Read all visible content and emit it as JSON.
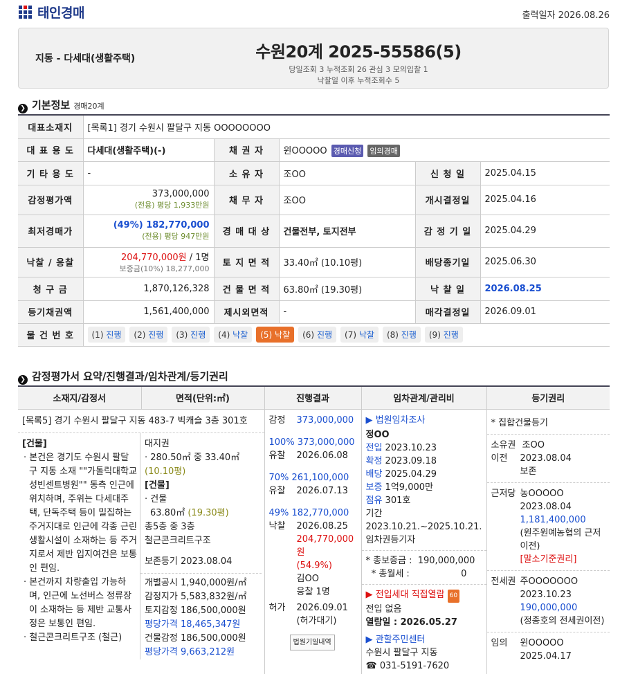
{
  "brand": {
    "name": "태인경매"
  },
  "print_date": "출력일자 2026.08.26",
  "header": {
    "property_type": "지동 - 다세대(생활주택)",
    "case_no": "수원20계 2025-55586(5)",
    "stats": "당일조회 3   누적조회 26   관심 3   모의입찰 1",
    "stats2": "낙찰일 이후 누적조회수 5"
  },
  "basic": {
    "title": "기본정보",
    "sub": "경매20계",
    "labels": {
      "addr": "대표소재지",
      "use": "대 표 용 도",
      "other_use": "기 타 용 도",
      "appraisal": "감정평가액",
      "min_price": "최저경매가",
      "bid": "낙찰 / 응찰",
      "claim": "청 구 금",
      "reg_claim": "등기채권액",
      "item_no": "물 건 번 호",
      "creditor": "채 권 자",
      "owner": "소 유 자",
      "debtor": "채 무 자",
      "target": "경 매 대 상",
      "land_area": "토 지 면 적",
      "bldg_area": "건 물 면 적",
      "excl_area": "제시외면적",
      "apply": "신 청 일",
      "start": "개시결정일",
      "appr_date": "감 정 기 일",
      "div_end": "배당종기일",
      "won_date": "낙 찰 일",
      "sale_decision": "매각결정일"
    },
    "addr": "[목록1] 경기 수원시 팔달구 지동 OOOOOOOO",
    "use": "다세대(생활주택)(-)",
    "other_use": "-",
    "appraisal": "373,000,000",
    "appraisal_sub": "(전용) 평당 1,933만원",
    "min_price": "(49%) 182,770,000",
    "min_price_sub": "(전용) 평당 947만원",
    "bid_price": "204,770,000원",
    "bid_count": " / 1명",
    "deposit": "보증금(10%) 18,277,000",
    "claim": "1,870,126,328",
    "reg_claim": "1,561,400,000",
    "creditor": "윈OOOOO",
    "badge1": "경매신청",
    "badge2": "임의경매",
    "owner": "조OO",
    "debtor": "조OO",
    "target": "건물전부, 토지전부",
    "land_area": "33.40㎡ (10.10평)",
    "bldg_area": "63.80㎡ (19.30평)",
    "excl_area": "-",
    "apply": "2025.04.15",
    "start": "2025.04.16",
    "appr_date": "2025.04.29",
    "div_end": "2025.06.30",
    "won_date": "2026.08.25",
    "sale_decision": "2026.09.01",
    "items": [
      {
        "n": "(1)",
        "s": "진행"
      },
      {
        "n": "(2)",
        "s": "진행"
      },
      {
        "n": "(3)",
        "s": "진행"
      },
      {
        "n": "(4)",
        "s": "낙찰"
      },
      {
        "n": "(5)",
        "s": "낙찰"
      },
      {
        "n": "(6)",
        "s": "진행"
      },
      {
        "n": "(7)",
        "s": "낙찰"
      },
      {
        "n": "(8)",
        "s": "진행"
      },
      {
        "n": "(9)",
        "s": "진행"
      }
    ]
  },
  "summary": {
    "title": "감정평가서 요약/진행결과/임차관계/등기권리",
    "cols": [
      "소재지/감정서",
      "면적(단위:㎡)",
      "진행결과",
      "임차관계/관리비",
      "등기권리"
    ],
    "location": "[목록5] 경기 수원시 팔달구 지동 483-7 빅캐슬 3층 301호",
    "bldg_head": "[건물]",
    "bullets": [
      "본건은 경기도 수원시 팔달구 지동 소재 \"\"가톨릭대학교 성빈센트병원\"\" 동측 인근에 위치하며, 주위는 다세대주택, 단독주택 등이 밀집하는 주거지대로 인근에 각종 근린생활시설이 소재하는 등 주거지로서 제반 입지여건은 보통인 편임.",
      "본건까지 차량출입 가능하며, 인근에 노선버스 정류장이 소재하는 등 제반 교통사정은 보통인 편임.",
      "철근콘크리트구조 (철근)"
    ],
    "area": {
      "land_right": "대지권",
      "land_val": "· 280.50㎡ 중 33.40㎡ ",
      "land_py": "(10.10평)",
      "bldg_head": "[건물]",
      "bldg_item": "· 건물",
      "bldg_val": "63.80㎡ ",
      "bldg_py": "(19.30평)",
      "floors": "총5층 중 3층",
      "struct": "철근콘크리트구조",
      "reg": "보존등기  2023.08.04",
      "l1": "개별공시 1,940,000원/㎡",
      "l2": "감정지가 5,583,832원/㎡",
      "l3": "토지감정 186,500,000원",
      "l4": "평당가격 18,465,347원",
      "l5": "건물감정 186,500,000원",
      "l6": "평당가격 9,663,212원"
    },
    "progress": {
      "k1": "감정",
      "v1": "373,000,000",
      "p2": "100% 373,000,000",
      "k2": "유찰",
      "v2": "2026.06.08",
      "p3": "70%   261,100,000",
      "k3": "유찰",
      "v3": "2026.07.13",
      "p4": "49%   182,770,000",
      "k4": "낙찰",
      "v4": "2026.08.25",
      "v4b": "204,770,000원",
      "v4c": "(54.9%)",
      "v4d": "김OO",
      "v4e": "응찰 1명",
      "k5": "허가",
      "v5": "2026.09.01",
      "v5b": "(허가대기)",
      "btn": "법원기일내역"
    },
    "tenant": {
      "h1": "▶ 법원임차조사",
      "name": "정OO",
      "l1k": "전입",
      "l1v": " 2023.10.23",
      "l2k": "확정",
      "l2v": " 2023.09.18",
      "l3k": "배당",
      "l3v": " 2025.04.29",
      "l4k": "보증",
      "l4v": " 1억9,000만",
      "l5k": "점유",
      "l5v": " 301호",
      "l6": "기간 2023.10.21.~2025.10.21.",
      "l7": "임차권등기자",
      "tot1": "* 총보증금 :  190,000,000",
      "tot2": "  * 총월세 :                  0",
      "h2": "▶ 전입세대 직접열람",
      "h2b": "60",
      "l8": "전입 없음",
      "l9": "열람일 : 2026.05.27",
      "h3": "▶ 관할주민센터",
      "l10": "수원시 팔달구 지동",
      "l11": "☎ 031-5191-7620"
    },
    "reg": {
      "head": "* 집합건물등기",
      "r1k": "소유권",
      "r1v": "조OO",
      "r1bk": "이전",
      "r1bv": "2023.08.04",
      "r1c": "보존",
      "r2k": "근저당",
      "r2v": "농OOOOO",
      "r2b": "2023.08.04",
      "r2c": "1,181,400,000",
      "r2d": "(원주원예농협의 근저이전)",
      "r2e": "[말소기준권리]",
      "r3k": "전세권",
      "r3v": "주OOOOOOO",
      "r3b": "2023.10.23",
      "r3c": "190,000,000",
      "r3d": "(정종호의 전세권이전)",
      "r4k": "임의",
      "r4v": "윈OOOOO",
      "r4b": "2025.04.17"
    }
  }
}
